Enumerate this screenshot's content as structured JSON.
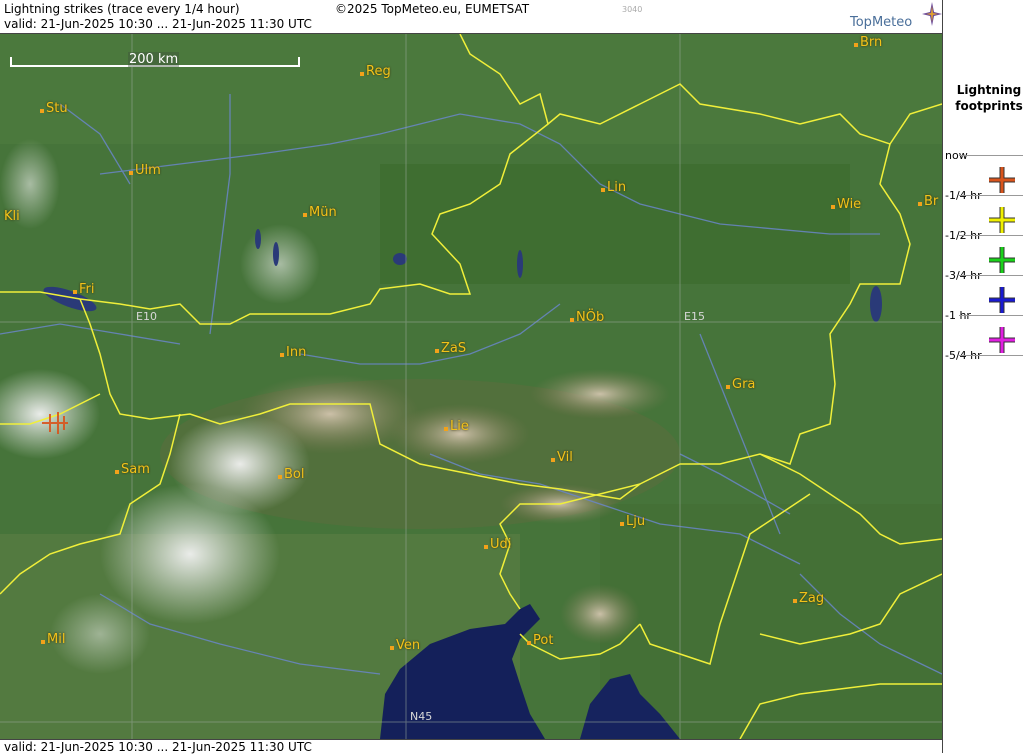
{
  "header": {
    "title": "Lightning strikes (trace every 1/4 hour)",
    "valid": "valid:  21-Jun-2025 10:30 ... 21-Jun-2025 11:30 UTC",
    "copyright": "©2025 TopMeteo.eu, EUMETSAT",
    "code": "3040",
    "logo_text": "TopMeteo"
  },
  "footer": {
    "valid": "valid:  21-Jun-2025 10:30 ... 21-Jun-2025 11:30 UTC"
  },
  "map": {
    "scale_label": "200 km",
    "grid_labels": [
      "E10",
      "E15",
      "N45"
    ],
    "cities": [
      {
        "name": "Brn"
      },
      {
        "name": "Reg"
      },
      {
        "name": "Stu"
      },
      {
        "name": "Ulm"
      },
      {
        "name": "Lin"
      },
      {
        "name": "Kli"
      },
      {
        "name": "Mün"
      },
      {
        "name": "Wie"
      },
      {
        "name": "Br"
      },
      {
        "name": "Fri"
      },
      {
        "name": "NÖb"
      },
      {
        "name": "Inn"
      },
      {
        "name": "ZaS"
      },
      {
        "name": "Gra"
      },
      {
        "name": "Lie"
      },
      {
        "name": "Vil"
      },
      {
        "name": "Sam"
      },
      {
        "name": "Bol"
      },
      {
        "name": "Lju"
      },
      {
        "name": "Udi"
      },
      {
        "name": "Zag"
      },
      {
        "name": "Mil"
      },
      {
        "name": "Ven"
      },
      {
        "name": "Pot"
      }
    ]
  },
  "legend": {
    "title": "Lightning footprints",
    "items": [
      {
        "label": "now",
        "color": "#d9541c"
      },
      {
        "label": "-1/4 hr",
        "color": "#f0f000"
      },
      {
        "label": "-1/2 hr",
        "color": "#19d219"
      },
      {
        "label": "-3/4 hr",
        "color": "#1a1ad2"
      },
      {
        "label": "-1 hr",
        "color": "#e11ee1"
      },
      {
        "label": "-5/4 hr",
        "color": ""
      }
    ]
  },
  "colors": {
    "border": "#f0ef3a",
    "land": "#3f6b2f",
    "sea": "#14205a",
    "river": "#6a86c8",
    "city": "#f2c21a"
  }
}
